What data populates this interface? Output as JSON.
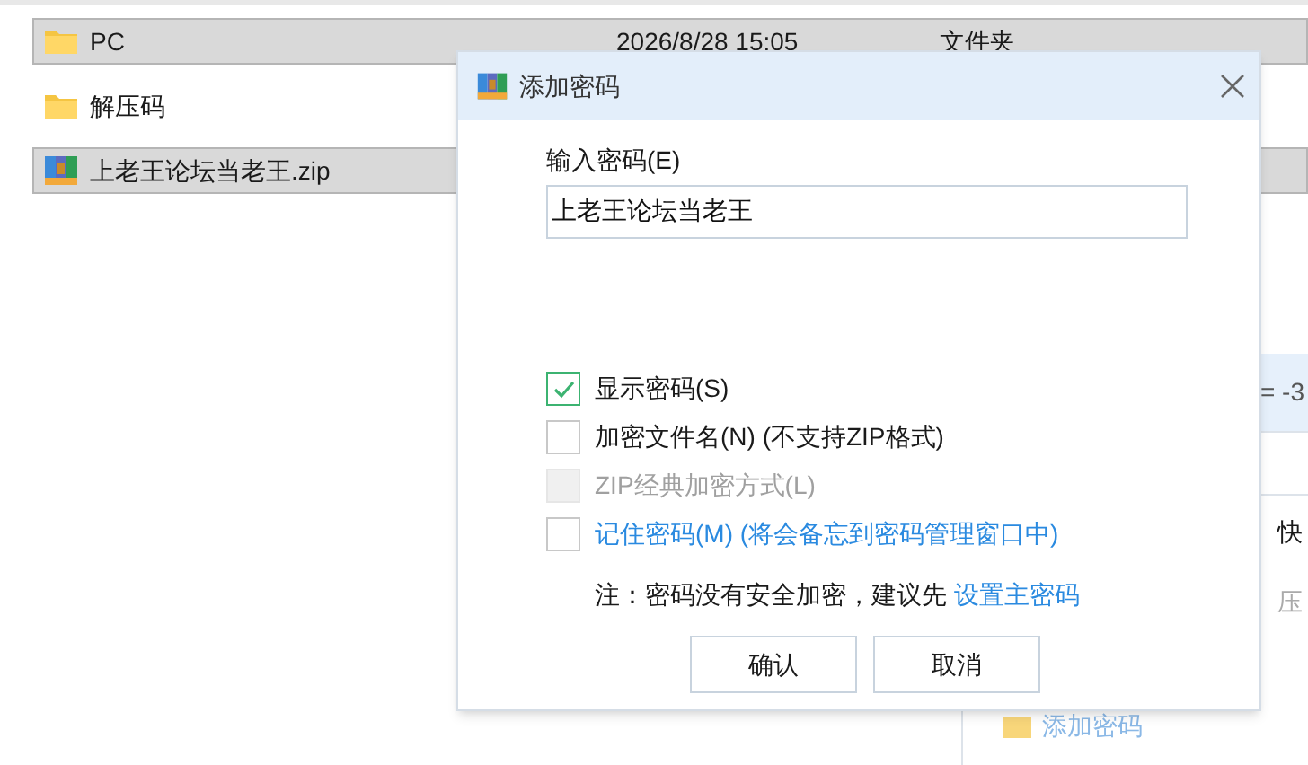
{
  "file_list": {
    "rows": [
      {
        "name": "PC",
        "kind": "folder",
        "date": "2026/8/28 15:05",
        "type": "文件夹",
        "selected": true
      },
      {
        "name": "解压码",
        "kind": "folder",
        "selected": false
      },
      {
        "name": "上老王论坛当老王.zip",
        "kind": "archive",
        "selected": true
      }
    ]
  },
  "side_panel": {
    "texts": [
      "= -3",
      "快",
      "压"
    ],
    "link": "添加密码"
  },
  "dialog": {
    "title": "添加密码",
    "password_label": "输入密码(E)",
    "password_value": "上老王论坛当老王",
    "options": [
      {
        "label": "显示密码(S)",
        "checked": true,
        "disabled": false,
        "kind": "plain"
      },
      {
        "label": "加密文件名(N) (不支持ZIP格式)",
        "checked": false,
        "disabled": false,
        "kind": "plain"
      },
      {
        "label": "ZIP经典加密方式(L)",
        "checked": false,
        "disabled": true,
        "kind": "plain"
      },
      {
        "label": "记住密码(M) (将会备忘到密码管理窗口中)",
        "checked": false,
        "disabled": false,
        "kind": "link"
      }
    ],
    "note": "注：密码没有安全加密，建议先",
    "note_link": "设置主密码",
    "buttons": [
      "确认",
      "取消"
    ]
  }
}
